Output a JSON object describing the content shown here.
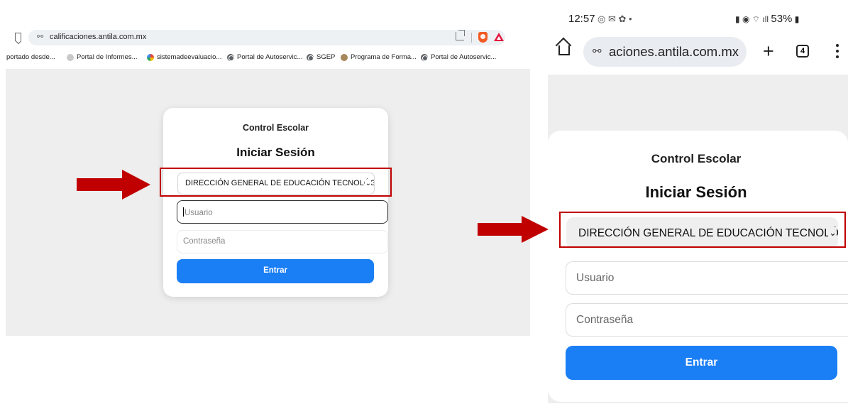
{
  "desktop": {
    "url": "calificaciones.antila.com.mx",
    "bookmarks": [
      "portado desde...",
      "Portal de Informes...",
      "sistemadeevaluacio...",
      "Portal de Autoservic...",
      "SGEP",
      "Programa de Forma...",
      "Portal de Autoservic..."
    ],
    "card": {
      "subtitle": "Control Escolar",
      "title": "Iniciar Sesión",
      "select_value": "DIRECCIÓN GENERAL DE EDUCACIÓN TECNOLÓGICA",
      "username_placeholder": "Usuario",
      "password_placeholder": "Contraseña",
      "submit_label": "Entrar"
    }
  },
  "phone": {
    "status": {
      "time": "12:57",
      "battery": "53%"
    },
    "url": "aciones.antila.com.mx",
    "tab_count": "4",
    "card": {
      "subtitle": "Control Escolar",
      "title": "Iniciar Sesión",
      "select_value": "DIRECCIÓN GENERAL DE EDUCACIÓN TECNOLÓGICA",
      "username_placeholder": "Usuario",
      "password_placeholder": "Contraseña",
      "submit_label": "Entrar"
    }
  },
  "colors": {
    "highlight": "#c00000",
    "button": "#1a7ef5",
    "background": "#eeeeee"
  }
}
